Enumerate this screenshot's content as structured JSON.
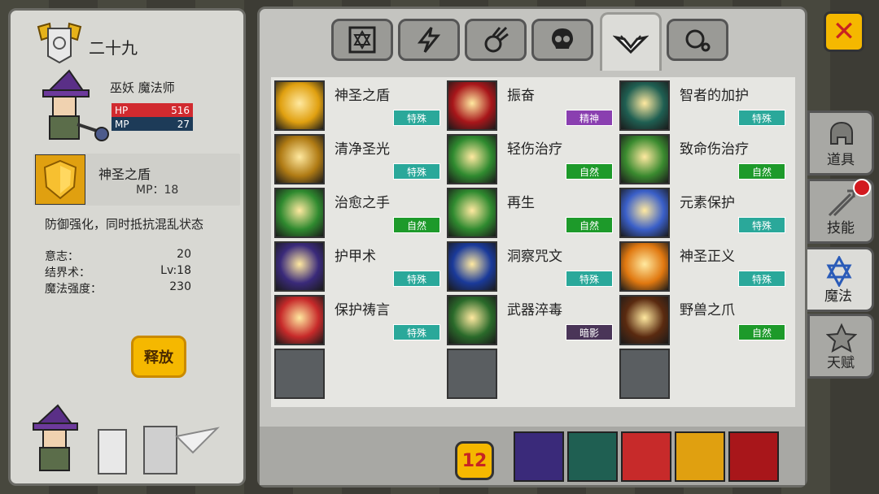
{
  "character": {
    "rank": "二十九",
    "class": "巫妖 魔法师",
    "hp_label": "HP",
    "hp": "516",
    "mp_label": "MP",
    "mp": "27"
  },
  "selected": {
    "name": "神圣之盾",
    "mp": "MP：18",
    "description": "防御强化，同时抵抗混乱状态",
    "stats": [
      {
        "label": "意志：",
        "value": "20"
      },
      {
        "label": "结界术：",
        "value": "Lv:18"
      },
      {
        "label": "魔法强度：",
        "value": "230"
      }
    ],
    "release_label": "释放"
  },
  "top_tabs": [
    "hexagram-icon",
    "lightning-icon",
    "comet-icon",
    "skull-icon",
    "wings-icon",
    "bubbles-icon"
  ],
  "skills": [
    {
      "name": "神圣之盾",
      "tag": "特殊",
      "tagcolor": "#2aa89a"
    },
    {
      "name": "振奋",
      "tag": "精神",
      "tagcolor": "#8a3fb0"
    },
    {
      "name": "智者的加护",
      "tag": "特殊",
      "tagcolor": "#2aa89a"
    },
    {
      "name": "清净圣光",
      "tag": "特殊",
      "tagcolor": "#2aa89a"
    },
    {
      "name": "轻伤治疗",
      "tag": "自然",
      "tagcolor": "#1d9a2a"
    },
    {
      "name": "致命伤治疗",
      "tag": "自然",
      "tagcolor": "#1d9a2a"
    },
    {
      "name": "治愈之手",
      "tag": "自然",
      "tagcolor": "#1d9a2a"
    },
    {
      "name": "再生",
      "tag": "自然",
      "tagcolor": "#1d9a2a"
    },
    {
      "name": "元素保护",
      "tag": "特殊",
      "tagcolor": "#2aa89a"
    },
    {
      "name": "护甲术",
      "tag": "特殊",
      "tagcolor": "#2aa89a"
    },
    {
      "name": "洞察咒文",
      "tag": "特殊",
      "tagcolor": "#2aa89a"
    },
    {
      "name": "神圣正义",
      "tag": "特殊",
      "tagcolor": "#2aa89a"
    },
    {
      "name": "保护祷言",
      "tag": "特殊",
      "tagcolor": "#2aa89a"
    },
    {
      "name": "武器淬毒",
      "tag": "暗影",
      "tagcolor": "#4a3558"
    },
    {
      "name": "野兽之爪",
      "tag": "自然",
      "tagcolor": "#1d9a2a"
    }
  ],
  "page_button": "12",
  "side_tabs": [
    {
      "label": "道具"
    },
    {
      "label": "技能"
    },
    {
      "label": "魔法"
    },
    {
      "label": "天赋"
    }
  ],
  "close_label": "✕"
}
